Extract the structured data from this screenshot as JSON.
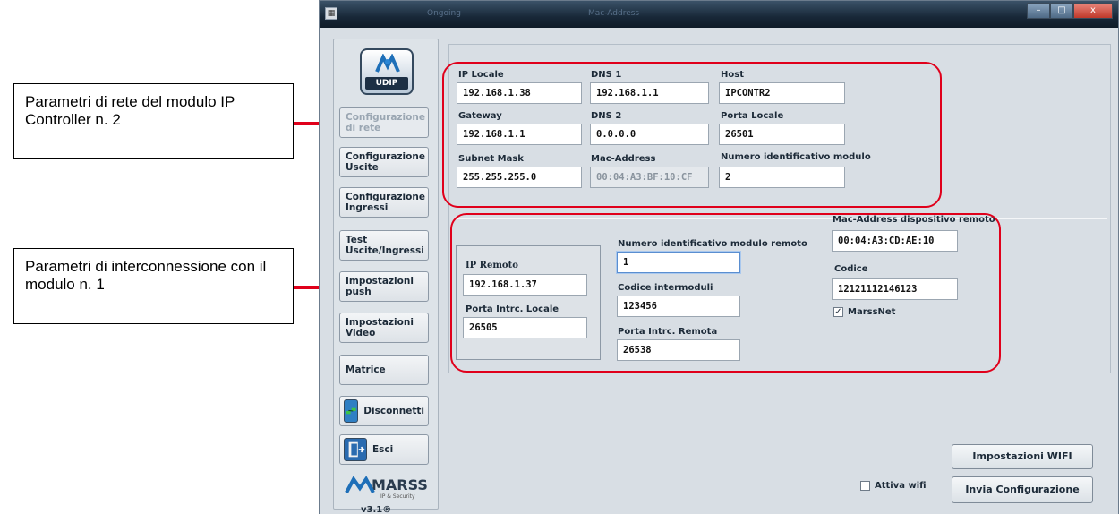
{
  "callouts": {
    "network": "Parametri di rete del modulo IP Controller n. 2",
    "interconnect": "Parametri di interconnessione con il modulo n. 1"
  },
  "window": {
    "title_faded_left": "Ongoing",
    "title_faded_right": "Mac-Address",
    "controls": {
      "minimize": "–",
      "maximize": "□",
      "close": "x"
    }
  },
  "sidebar": {
    "logo_text": "UDIP",
    "items": [
      {
        "label": "Configurazione di rete",
        "enabled": false
      },
      {
        "label": "Configurazione Uscite",
        "enabled": true
      },
      {
        "label": "Configurazione Ingressi",
        "enabled": true
      },
      {
        "label": "Test Uscite/Ingressi",
        "enabled": true
      },
      {
        "label": "Impostazioni push",
        "enabled": true
      },
      {
        "label": "Impostazioni Video",
        "enabled": true
      },
      {
        "label": "Matrice",
        "enabled": true
      }
    ],
    "disconnect_label": "Disconnetti",
    "exit_label": "Esci",
    "brand": "MARSS",
    "brand_sub": "IP & Security",
    "version": "v3.1®"
  },
  "network": {
    "ip_locale": {
      "label": "IP Locale",
      "value": "192.168.1.38"
    },
    "dns1": {
      "label": "DNS 1",
      "value": "192.168.1.1"
    },
    "host": {
      "label": "Host",
      "value": "IPCONTR2"
    },
    "gateway": {
      "label": "Gateway",
      "value": "192.168.1.1"
    },
    "dns2": {
      "label": "DNS 2",
      "value": "0.0.0.0"
    },
    "porta_locale": {
      "label": "Porta Locale",
      "value": "26501"
    },
    "subnet": {
      "label": "Subnet Mask",
      "value": "255.255.255.0"
    },
    "mac": {
      "label": "Mac-Address",
      "value": "00:04:A3:BF:10:CF"
    },
    "module_id": {
      "label": "Numero identificativo modulo",
      "value": "2"
    }
  },
  "interconnect": {
    "ip_remoto": {
      "label": "IP Remoto",
      "value": "192.168.1.37"
    },
    "porta_locale": {
      "label": "Porta Intrc. Locale",
      "value": "26505"
    },
    "remote_id": {
      "label": "Numero identificativo modulo remoto",
      "value": "1"
    },
    "codice_intermoduli": {
      "label": "Codice intermoduli",
      "value": "123456"
    },
    "porta_remota": {
      "label": "Porta Intrc. Remota",
      "value": "26538"
    },
    "remote_mac": {
      "label": "Mac-Address dispositivo remoto",
      "value": "00:04:A3:CD:AE:10"
    },
    "codice": {
      "label": "Codice",
      "value": "12121112146123"
    },
    "marssnet": {
      "label": "MarssNet",
      "checked": true
    }
  },
  "bottom": {
    "wifi_settings": "Impostazioni WIFI",
    "send_config": "Invia Configurazione",
    "wifi_toggle": {
      "label": "Attiva wifi",
      "checked": false
    }
  }
}
